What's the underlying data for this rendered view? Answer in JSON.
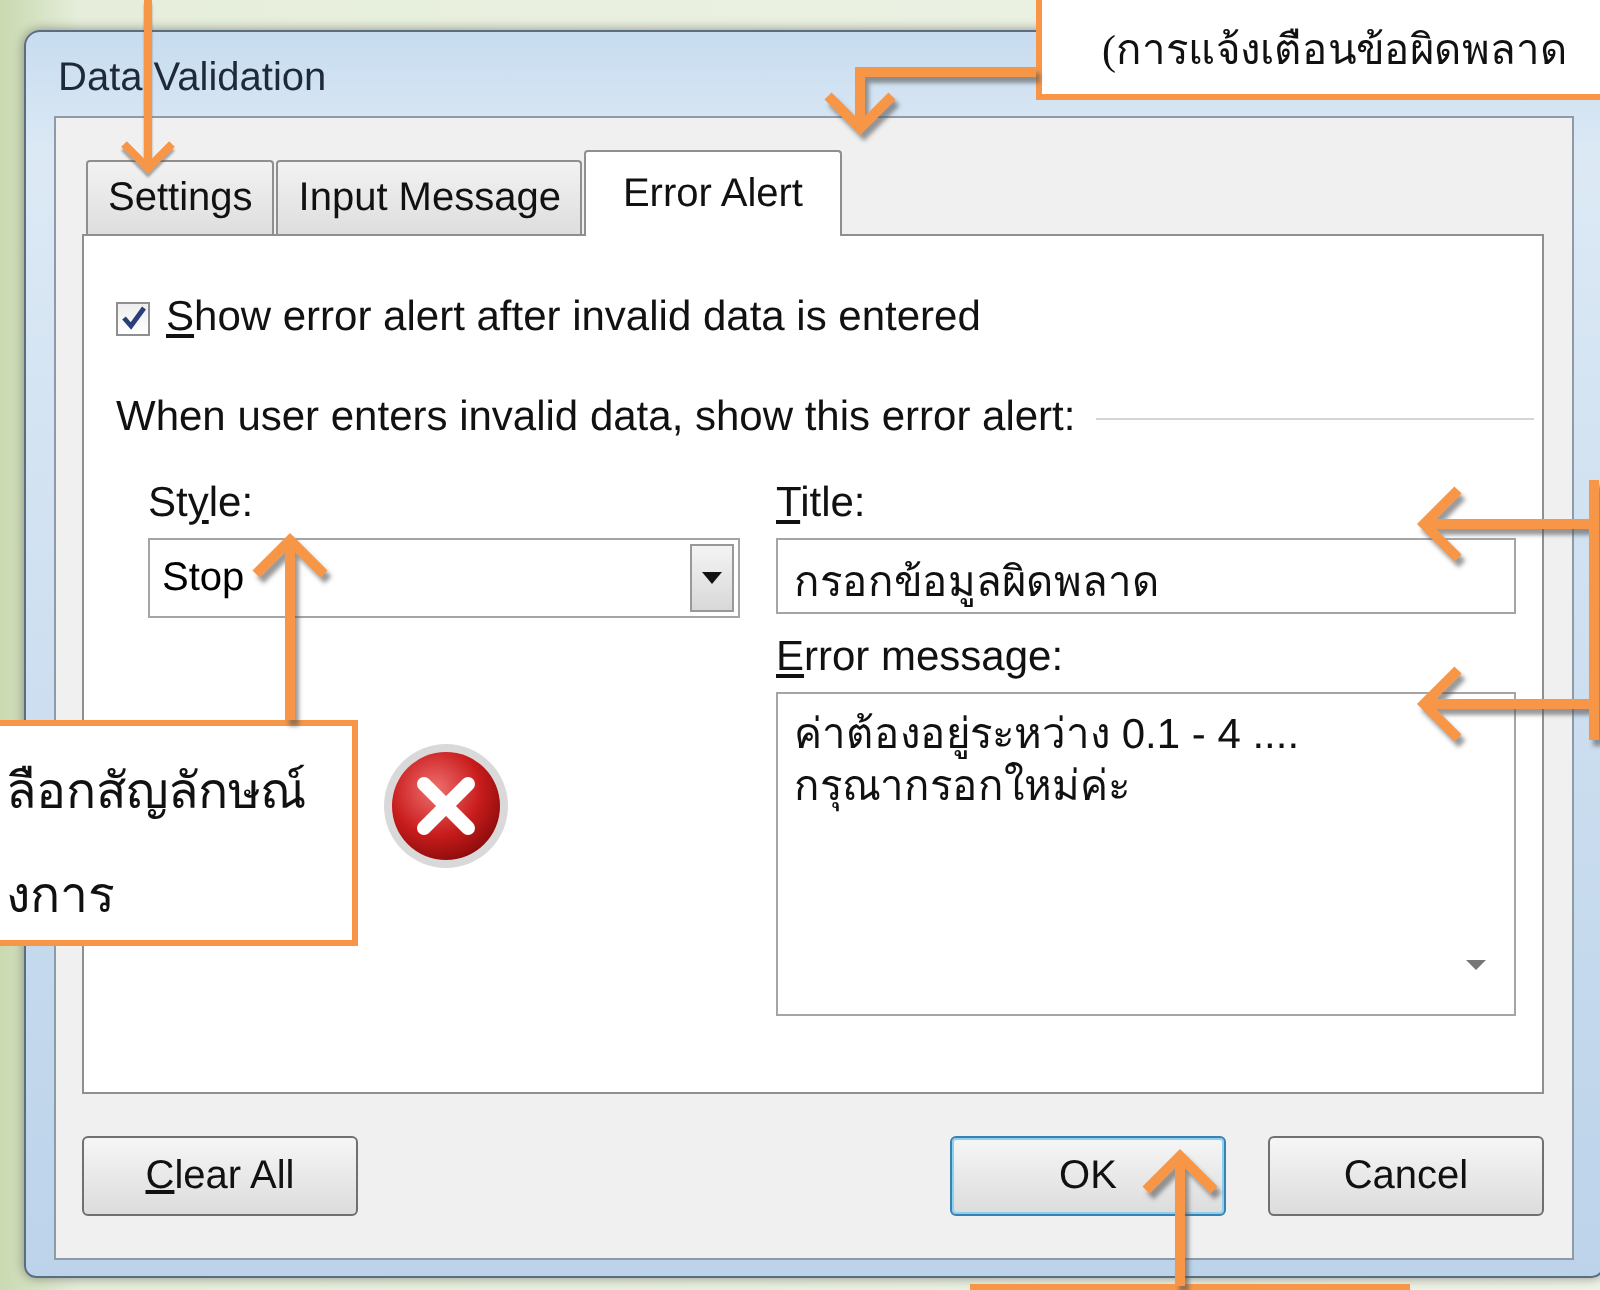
{
  "window": {
    "title": "Data Validation"
  },
  "tabs": [
    {
      "label": "Settings",
      "selected": false
    },
    {
      "label": "Input Message",
      "selected": false
    },
    {
      "label": "Error Alert",
      "selected": true
    }
  ],
  "show_alert": {
    "label_parts": [
      {
        "text": "S",
        "underlined": true
      },
      {
        "text": "how error alert after invalid data is entered",
        "underlined": false
      }
    ],
    "checked": true
  },
  "section_label": "When user enters invalid data, show this error alert:",
  "style": {
    "label_parts": [
      {
        "text": "St",
        "underlined": false
      },
      {
        "text": "y",
        "underlined": true
      },
      {
        "text": "le:",
        "underlined": false
      }
    ],
    "value": "Stop"
  },
  "title_field": {
    "label_parts": [
      {
        "text": "T",
        "underlined": true
      },
      {
        "text": "itle:",
        "underlined": false
      }
    ],
    "value": "กรอกข้อมูลผิดพลาด"
  },
  "message_field": {
    "label_parts": [
      {
        "text": "E",
        "underlined": true
      },
      {
        "text": "rror message:",
        "underlined": false
      }
    ],
    "lines": [
      "ค่าต้องอยู่ระหว่าง 0.1 - 4 ....",
      "กรุณากรอกใหม่ค่ะ"
    ]
  },
  "buttons": [
    {
      "label_parts": [
        {
          "text": "C",
          "underlined": true
        },
        {
          "text": "lear All",
          "underlined": false
        }
      ],
      "default": false
    },
    {
      "label_parts": [
        {
          "text": "OK",
          "underlined": false
        }
      ],
      "default": true
    },
    {
      "label_parts": [
        {
          "text": "Cancel",
          "underlined": false
        }
      ],
      "default": false
    }
  ],
  "callouts": [
    {
      "lines": [
        "(การแจ้งเตือนข้อผิดพลาด"
      ]
    },
    {
      "lines": [
        "ลือกสัญลักษณ์",
        "งการ"
      ]
    }
  ]
}
